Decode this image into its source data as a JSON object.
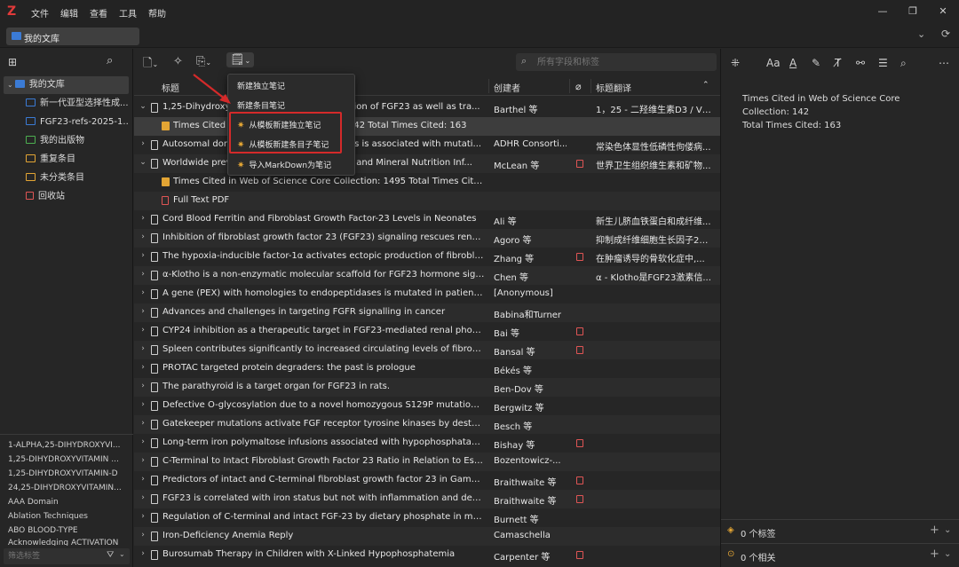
{
  "app": {
    "logo": "Z",
    "menu": [
      "文件",
      "编辑",
      "查看",
      "工具",
      "帮助"
    ],
    "tab_label": "我的文库"
  },
  "collections": [
    {
      "label": "我的文库",
      "level": 0,
      "selected": true
    },
    {
      "label": "新一代亚型选择性成...",
      "level": 1
    },
    {
      "label": "FGF23-refs-2025-1...",
      "level": 1
    },
    {
      "label": "我的出版物",
      "level": 1
    },
    {
      "label": "重复条目",
      "level": 1
    },
    {
      "label": "未分类条目",
      "level": 1
    },
    {
      "label": "回收站",
      "level": 1
    }
  ],
  "tags": [
    "1-ALPHA,25-DIHYDROXYVI...",
    "1,25-DIHYDROXYVITAMIN ...",
    "1,25-DIHYDROXYVITAMIN-D",
    "24,25-DIHYDROXYVITAMIN...",
    "AAA Domain",
    "Ablation Techniques",
    "ABO BLOOD-TYPE",
    "Acknowledging ACTIVATION"
  ],
  "tag_filter_placeholder": "筛选标签",
  "search_placeholder": "所有字段和标签",
  "columns": {
    "title": "标题",
    "creator": "创建者",
    "translation": "标题翻译"
  },
  "dropdown": {
    "items": [
      "新建独立笔记",
      "新建条目笔记",
      "从模板新建独立笔记",
      "从模板新建条目子笔记",
      "导入MarkDown为笔记"
    ]
  },
  "rows": [
    {
      "kind": "item",
      "expanded": true,
      "title": "1,25-Dihydroxy",
      "title_tail": "ction of FGF23 as well as tra...",
      "creator": "Barthel 等",
      "translation": "1，25 - 二羟维生素D3 / VD...",
      "pdf": false
    },
    {
      "kind": "note",
      "title": "Times Cited i",
      "title_tail": "on: 142 Total Times Cited: 163",
      "selected": true
    },
    {
      "kind": "item",
      "expanded": false,
      "title": "Autosomal dom",
      "title_tail": "ets is associated with mutati...",
      "creator": "ADHR Consorti...",
      "translation": "常染色体显性低磷性佝偻病...",
      "pdf": false
    },
    {
      "kind": "item",
      "expanded": true,
      "title": "Worldwide prev",
      "title_tail": "in and Mineral Nutrition Inf...",
      "creator": "McLean 等",
      "translation": "世界卫生组织维生素和矿物...",
      "pdf": true
    },
    {
      "kind": "note",
      "title": "Times Cited in Web of Science Core Collection: 1495 Total Times Cited: ..."
    },
    {
      "kind": "pdf",
      "title": "Full Text PDF"
    },
    {
      "kind": "item",
      "expanded": false,
      "title": "Cord Blood Ferritin and Fibroblast Growth Factor-23 Levels in Neonates",
      "creator": "Ali 等",
      "translation": "新生儿脐血铁蛋白和成纤维...",
      "pdf": false
    },
    {
      "kind": "item",
      "expanded": false,
      "title": "Inhibition of fibroblast growth factor 23 (FGF23) signaling rescues renal ane...",
      "creator": "Agoro 等",
      "translation": "抑制成纤维细胞生长因子23...",
      "pdf": false
    },
    {
      "kind": "item",
      "expanded": false,
      "title": "The hypoxia-inducible factor-1α activates ectopic production of fibroblast g...",
      "creator": "Zhang 等",
      "translation": "在肿瘤诱导的骨软化症中,...",
      "pdf": true
    },
    {
      "kind": "item",
      "expanded": false,
      "title": "α-Klotho is a non-enzymatic molecular scaffold for FGF23 hormone signalli...",
      "creator": "Chen 等",
      "translation": "α - Klotho是FGF23激素信...",
      "pdf": false
    },
    {
      "kind": "item",
      "expanded": false,
      "title": "A gene (PEX) with homologies to endopeptidases is mutated in patients wit...",
      "creator": "[Anonymous]",
      "translation": "",
      "pdf": false
    },
    {
      "kind": "item",
      "expanded": false,
      "title": "Advances and challenges in targeting FGFR signalling in cancer",
      "creator": "Babina和Turner",
      "translation": "",
      "pdf": false
    },
    {
      "kind": "item",
      "expanded": false,
      "title": "CYP24 inhibition as a therapeutic target in FGF23-mediated renal phosphat...",
      "creator": "Bai 等",
      "translation": "",
      "pdf": true
    },
    {
      "kind": "item",
      "expanded": false,
      "title": "Spleen contributes significantly to increased circulating levels of fibroblast ...",
      "creator": "Bansal 等",
      "translation": "",
      "pdf": true
    },
    {
      "kind": "item",
      "expanded": false,
      "title": "PROTAC targeted protein degraders: the past is prologue",
      "creator": "Békés 等",
      "translation": "",
      "pdf": false
    },
    {
      "kind": "item",
      "expanded": false,
      "title": "The parathyroid is a target organ for FGF23 in rats.",
      "creator": "Ben-Dov 等",
      "translation": "",
      "pdf": false
    },
    {
      "kind": "item",
      "expanded": false,
      "title": "Defective O-glycosylation due to a novel homozygous S129P mutation is as...",
      "creator": "Bergwitz 等",
      "translation": "",
      "pdf": false
    },
    {
      "kind": "item",
      "expanded": false,
      "title": "Gatekeeper mutations activate FGF receptor tyrosine kinases by destabilizin...",
      "creator": "Besch 等",
      "translation": "",
      "pdf": false
    },
    {
      "kind": "item",
      "expanded": false,
      "title": "Long-term iron polymaltose infusions associated with hypophosphataemic ...",
      "creator": "Bishay 等",
      "translation": "",
      "pdf": true
    },
    {
      "kind": "item",
      "expanded": false,
      "title": "C-Terminal to Intact Fibroblast Growth Factor 23 Ratio in Relation to Estima...",
      "creator": "Bozentowicz-...",
      "translation": "",
      "pdf": false
    },
    {
      "kind": "item",
      "expanded": false,
      "title": "Predictors of intact and C-terminal fibroblast growth factor 23 in Gambian c...",
      "creator": "Braithwaite 等",
      "translation": "",
      "pdf": true
    },
    {
      "kind": "item",
      "expanded": false,
      "title": "FGF23 is correlated with iron status but not with inflammation and decreas...",
      "creator": "Braithwaite 等",
      "translation": "",
      "pdf": true
    },
    {
      "kind": "item",
      "expanded": false,
      "title": "Regulation of C-terminal and intact FGF-23 by dietary phosphate in men an...",
      "creator": "Burnett 等",
      "translation": "",
      "pdf": false
    },
    {
      "kind": "item",
      "expanded": false,
      "title": "Iron-Deficiency Anemia Reply",
      "creator": "Camaschella",
      "translation": "",
      "pdf": false
    },
    {
      "kind": "item",
      "expanded": false,
      "title": "Burosumab Therapy in Children with X-Linked Hypophosphatemia",
      "creator": "Carpenter 等",
      "translation": "",
      "pdf": true
    }
  ],
  "note_view": {
    "line1": "Times Cited in Web of Science Core",
    "line2": "Collection:  142",
    "line3": "Total Times Cited:  163"
  },
  "right_sections": {
    "tags": "0 个标签",
    "related": "0 个相关"
  },
  "colors": {
    "accent": "#3b7bd5",
    "note": "#e3a534",
    "pdf": "#e05555",
    "highlight": "#d42a2a"
  }
}
